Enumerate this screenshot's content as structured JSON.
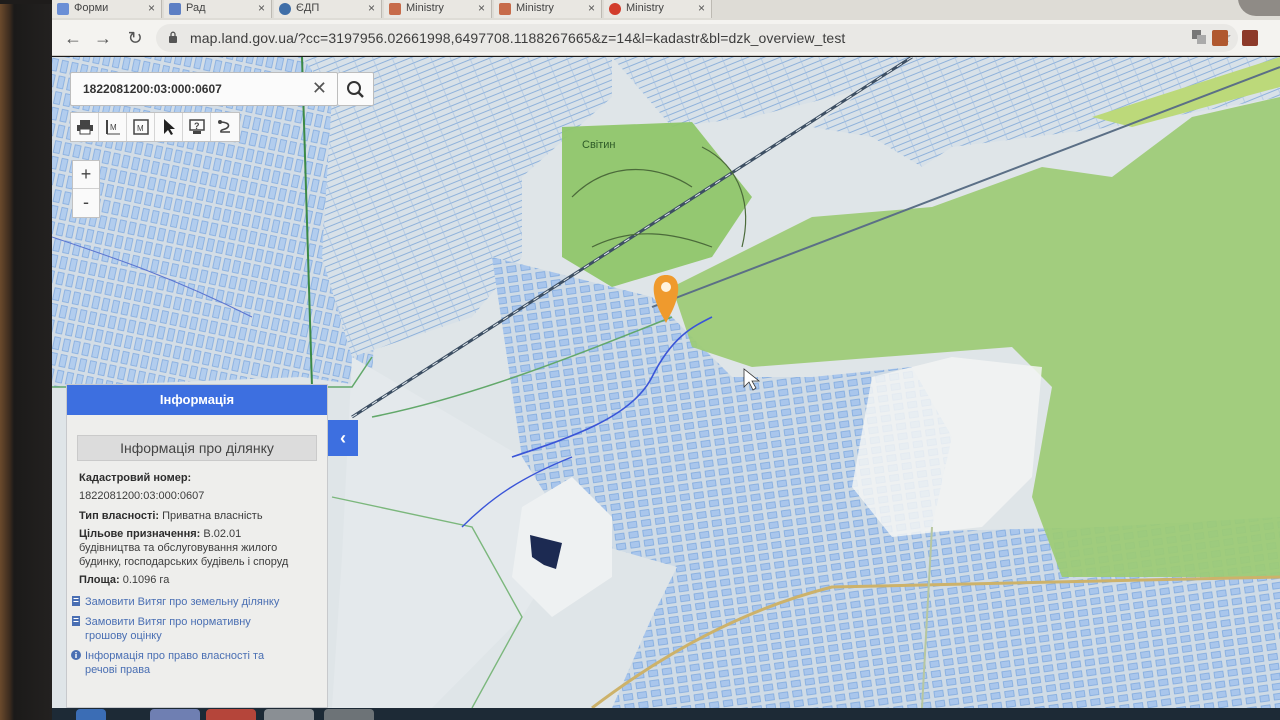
{
  "browser": {
    "tabs": [
      {
        "label": "Форми",
        "color": "#6b8fd6"
      },
      {
        "label": "Рад",
        "color": "#5d7fc4"
      },
      {
        "label": "ЄДП",
        "color": "#3f6ea8"
      },
      {
        "label": "Ministry",
        "color": "#c76b4a"
      },
      {
        "label": "Ministry",
        "color": "#c76b4a"
      },
      {
        "label": "Ministry",
        "color": "#d23c2c"
      }
    ],
    "url": "map.land.gov.ua/?cc=3197956.02661998,6497708.1188267665&z=14&l=kadastr&bl=dzk_overview_test",
    "back_icon": "arrow-left-icon",
    "forward_icon": "arrow-right-icon",
    "reload_icon": "reload-icon"
  },
  "map": {
    "search": {
      "value": "1822081200:03:000:0607",
      "clear_glyph": "✕",
      "button_icon": "search-icon"
    },
    "tools": [
      "print-icon",
      "measure-icon",
      "area-icon",
      "pointer-icon",
      "identify-icon",
      "route-icon"
    ],
    "zoom": {
      "in": "+",
      "out": "-"
    },
    "place_label": "Світин",
    "colors": {
      "parcel_fill": "#a9c6ec",
      "parcel_stroke": "#5b8fd6",
      "forest": "#8fc66a",
      "road": "#cdb26a",
      "railway": "#3d4f63",
      "marker": "#ef9a2d",
      "selected_parcel": "#1c2a52"
    }
  },
  "info_panel": {
    "header": "Інформація",
    "title": "Інформація про ділянку",
    "cadastral_label": "Кадастровий номер:",
    "cadastral_value": "1822081200:03:000:0607",
    "ownership_label": "Тип власності:",
    "ownership_value": "Приватна власність",
    "purpose_label": "Цільове призначення:",
    "purpose_value_1": "В.02.01",
    "purpose_value_2": "будівництва та обслуговування жилого",
    "purpose_value_3": "будинку, господарських будівель і споруд",
    "area_label": "Площа:",
    "area_value": "0.1096 га",
    "link_1": "Замовити Витяг про земельну ділянку",
    "link_2a": "Замовити Витяг про нормативну",
    "link_2b": "грошову оцінку",
    "link_3a": "Інформація про право власності та",
    "link_3b": "речові права",
    "collapse_glyph": "‹"
  }
}
